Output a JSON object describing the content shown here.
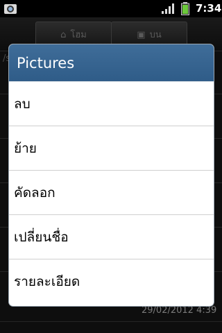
{
  "status_bar": {
    "time": "7:34",
    "notification_icon": "camera-notification-icon",
    "signal_icon": "signal-icon",
    "battery_icon": "battery-icon"
  },
  "background": {
    "home_label": "โฮม",
    "up_label": "บน",
    "path_prefix": "/s",
    "date": "29/02/2012 4:39"
  },
  "dialog": {
    "title": "Pictures",
    "items": [
      {
        "label": "ลบ"
      },
      {
        "label": "ย้าย"
      },
      {
        "label": "คัดลอก"
      },
      {
        "label": "เปลี่ยนชื่อ"
      },
      {
        "label": "รายละเอียด"
      }
    ]
  },
  "colors": {
    "header": "#2f5c88",
    "dialog_bg": "#ffffff",
    "battery": "#6cc93b"
  }
}
